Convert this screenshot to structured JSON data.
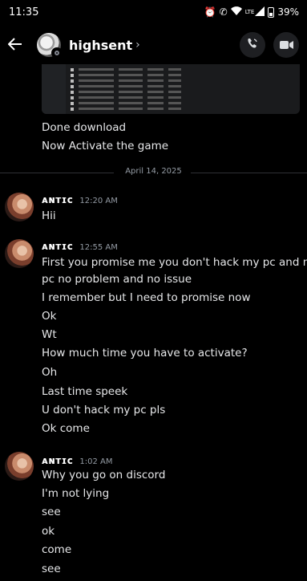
{
  "status_bar": {
    "time": "11:35",
    "network": "LTE",
    "battery": "39%",
    "icons": [
      "alarm-icon",
      "wifi-calling-icon",
      "wifi-icon",
      "signal-icon",
      "battery-icon"
    ]
  },
  "header": {
    "username": "highsent",
    "chevron": "›",
    "icons": [
      "back-arrow-icon",
      "voice-call-icon",
      "video-call-icon"
    ]
  },
  "previous_messages": [
    "Done download",
    "Now Activate the game"
  ],
  "date_divider": "April 14, 2025",
  "groups": [
    {
      "author": "ᴀɴᴛɪᴄ",
      "time": "12:20 AM",
      "lines": [
        "Hii"
      ]
    },
    {
      "author": "ᴀɴᴛɪᴄ",
      "time": "12:55 AM",
      "lines": [
        "First you promise me you don't hack my pc and my",
        "pc no problem and no issue",
        "I remember but I need to promise now",
        "Ok",
        "Wt",
        "How much time you have to activate?",
        "Oh",
        "Last time speek",
        "U don't hack my pc pls",
        "Ok come"
      ]
    },
    {
      "author": "ᴀɴᴛɪᴄ",
      "time": "1:02 AM",
      "lines": [
        "Why you go on discord",
        "I'm not lying",
        "see",
        "ok",
        "come",
        "see"
      ]
    }
  ],
  "colors": {
    "background": "#000000",
    "text": "#e6e7e9",
    "muted": "#949ba4",
    "button_bg": "#1e1f22"
  }
}
